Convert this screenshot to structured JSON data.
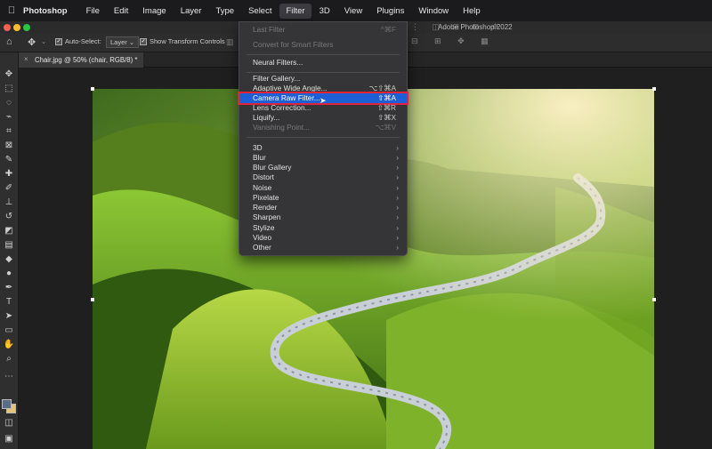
{
  "menubar": {
    "app_name": "Photoshop",
    "items": [
      "File",
      "Edit",
      "Image",
      "Layer",
      "Type",
      "Select",
      "Filter",
      "3D",
      "View",
      "Plugins",
      "Window",
      "Help"
    ],
    "active_item": "Filter"
  },
  "window": {
    "title": "Adobe Photoshop 2022"
  },
  "options_bar": {
    "auto_select_label": "Auto-Select:",
    "auto_select_value": "Layer",
    "show_transform_label": "Show Transform Controls"
  },
  "document_tab": {
    "label": "Chair.jpg @ 50% (chair, RGB/8) *"
  },
  "filter_menu": {
    "items": [
      {
        "label": "Last Filter",
        "shortcut": "^⌘F",
        "disabled": true
      },
      {
        "label": "Convert for Smart Filters",
        "shortcut": "",
        "disabled": true
      },
      {
        "label": "Neural Filters...",
        "shortcut": ""
      },
      {
        "label": "Filter Gallery...",
        "shortcut": ""
      },
      {
        "label": "Adaptive Wide Angle...",
        "shortcut": "⌥⇧⌘A"
      },
      {
        "label": "Camera Raw Filter...",
        "shortcut": "⇧⌘A",
        "highlighted": true
      },
      {
        "label": "Lens Correction...",
        "shortcut": "⇧⌘R"
      },
      {
        "label": "Liquify...",
        "shortcut": "⇧⌘X"
      },
      {
        "label": "Vanishing Point...",
        "shortcut": "⌥⌘V",
        "disabled": true
      },
      {
        "label": "3D",
        "submenu": true
      },
      {
        "label": "Blur",
        "submenu": true
      },
      {
        "label": "Blur Gallery",
        "submenu": true
      },
      {
        "label": "Distort",
        "submenu": true
      },
      {
        "label": "Noise",
        "submenu": true
      },
      {
        "label": "Pixelate",
        "submenu": true
      },
      {
        "label": "Render",
        "submenu": true
      },
      {
        "label": "Sharpen",
        "submenu": true
      },
      {
        "label": "Stylize",
        "submenu": true
      },
      {
        "label": "Video",
        "submenu": true
      },
      {
        "label": "Other",
        "submenu": true
      }
    ],
    "submenu_arrow": "›"
  },
  "colors": {
    "highlight": "#1f5fd6",
    "highlight_outline": "#e0243a",
    "foreground_swatch": "#5a6d86",
    "background_swatch": "#e3c47a"
  }
}
